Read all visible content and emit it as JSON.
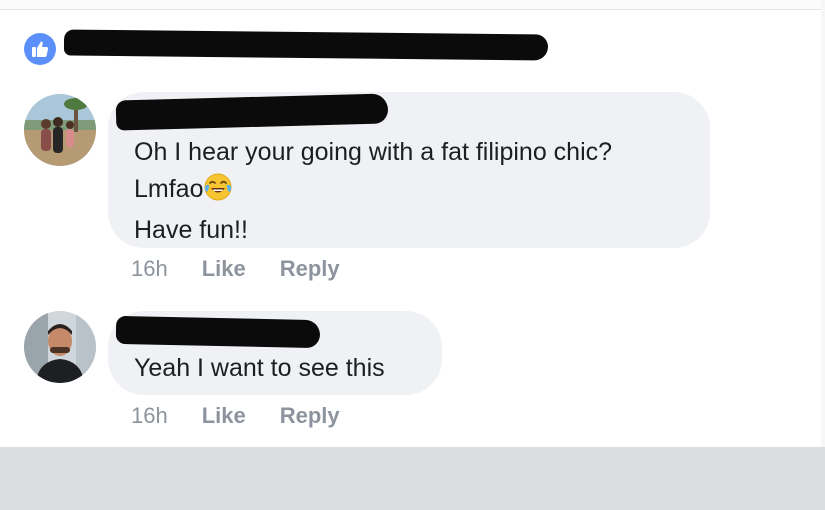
{
  "reactions": {
    "like_icon": "thumbs-up-icon",
    "like_color": "#5b8ff9"
  },
  "comments": [
    {
      "text_lines": [
        "Oh I hear your going with a fat filipino chic?",
        "Lmfao",
        "Have fun!!"
      ],
      "emoji": "face-with-tears-of-joy",
      "time": "16h",
      "like_label": "Like",
      "reply_label": "Reply"
    },
    {
      "text_lines": [
        "Yeah I want to see this"
      ],
      "time": "16h",
      "like_label": "Like",
      "reply_label": "Reply"
    }
  ],
  "colors": {
    "bubble": "#f0f1f4",
    "text": "#1c1e21",
    "meta": "#8d949e",
    "footer": "#dcdde0"
  }
}
